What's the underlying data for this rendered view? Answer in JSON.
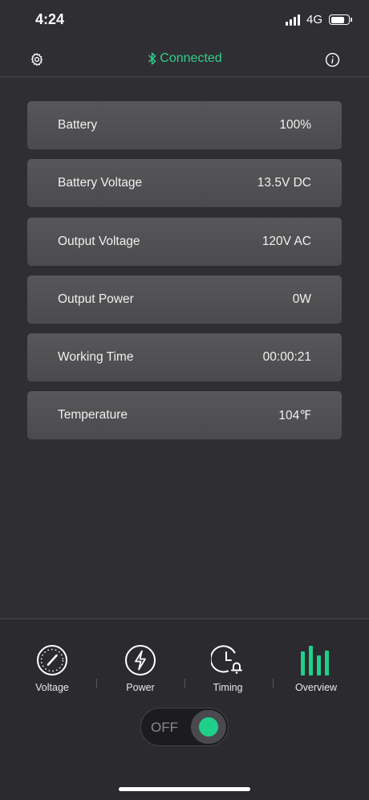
{
  "status_bar": {
    "time": "4:24",
    "network": "4G",
    "battery_level": 0.8
  },
  "header": {
    "connection_status": "Connected",
    "accent_color": "#2fd08a",
    "left_icon": "gear-icon",
    "right_icon": "info-icon"
  },
  "info_items": [
    {
      "label": "Battery",
      "value": "100%"
    },
    {
      "label": "Battery Voltage",
      "value": "13.5V DC"
    },
    {
      "label": "Output Voltage",
      "value": "120V AC"
    },
    {
      "label": "Output Power",
      "value": "0W"
    },
    {
      "label": "Working Time",
      "value": "00:00:21"
    },
    {
      "label": "Temperature",
      "value": "104℉"
    }
  ],
  "tabs": [
    {
      "label": "Voltage",
      "icon": "gauge-icon"
    },
    {
      "label": "Power",
      "icon": "lightning-icon"
    },
    {
      "label": "Timing",
      "icon": "clock-bell-icon"
    },
    {
      "label": "Overview",
      "icon": "bars-icon",
      "active": true
    }
  ],
  "power_toggle": {
    "label": "OFF",
    "knob_color": "#1ed08a"
  }
}
